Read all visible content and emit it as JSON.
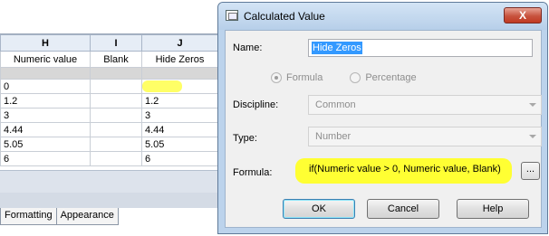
{
  "spreadsheet": {
    "column_letters": [
      "H",
      "I",
      "J"
    ],
    "column_headers": [
      "Numeric value",
      "Blank",
      "Hide Zeros"
    ],
    "rows": [
      [
        "0",
        "",
        ""
      ],
      [
        "1.2",
        "",
        "1.2"
      ],
      [
        "3",
        "",
        "3"
      ],
      [
        "4.44",
        "",
        "4.44"
      ],
      [
        "5.05",
        "",
        "5.05"
      ],
      [
        "6",
        "",
        "6"
      ]
    ],
    "tabs": [
      "Formatting",
      "Appearance"
    ],
    "highlight_color": "#ffff55"
  },
  "dialog": {
    "title": "Calculated Value",
    "close_label": "X",
    "name_label": "Name:",
    "name_value": "Hide Zeros",
    "radio_formula": "Formula",
    "radio_percentage": "Percentage",
    "radio_selected": "Formula",
    "discipline_label": "Discipline:",
    "discipline_value": "Common",
    "type_label": "Type:",
    "type_value": "Number",
    "formula_label": "Formula:",
    "formula_value": "if(Numeric value > 0, Numeric value, Blank)",
    "ellipsis_label": "...",
    "ok_label": "OK",
    "cancel_label": "Cancel",
    "help_label": "Help",
    "icons": [
      "window-icon",
      "close-icon",
      "chevron-down-icon"
    ],
    "highlight_color": "#ffff33",
    "selection_color": "#3399ff"
  }
}
